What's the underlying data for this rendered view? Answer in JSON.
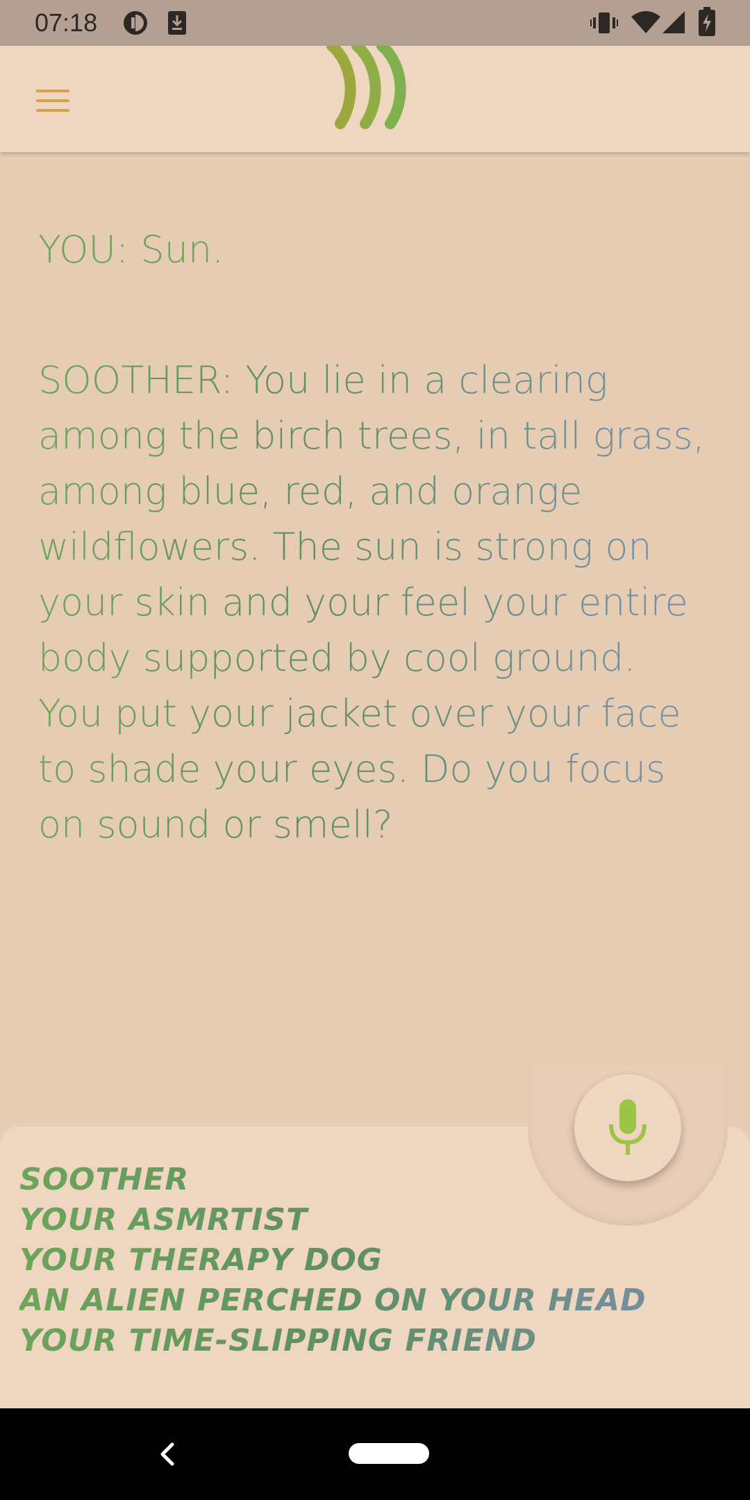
{
  "status_bar": {
    "time": "07:18",
    "left_icons": [
      "privacy-indicator-icon",
      "download-icon"
    ],
    "right_icons": [
      "vibrate-icon",
      "wifi-icon",
      "signal-icon",
      "battery-charging-icon"
    ]
  },
  "app_bar": {
    "menu_icon": "hamburger-menu-icon",
    "logo_icon": "sound-waves-logo-icon"
  },
  "conversation": {
    "messages": [
      {
        "speaker": "YOU:",
        "text": " Sun."
      },
      {
        "speaker": "SOOTHER:",
        "text": " You lie in a clearing among the birch trees, in tall grass, among blue, red, and orange wildflowers. The sun is strong on your skin and your feel your entire body supported by cool ground. You put your jacket over your face to shade your eyes. Do you focus on sound or smell?"
      }
    ]
  },
  "mic": {
    "icon": "microphone-icon"
  },
  "personas": [
    "SOOTHER",
    "YOUR ASMRTIST",
    "YOUR THERAPY DOG",
    "AN ALIEN PERCHED ON YOUR HEAD",
    "YOUR TIME-SLIPPING FRIEND"
  ],
  "nav_bar": {
    "back_icon": "back-chevron-icon",
    "home_icon": "home-pill-icon"
  },
  "colors": {
    "background": "#e6ccb2",
    "panel": "#efd6c1",
    "green": "#6da55a",
    "blue_gray": "#7a8fb0",
    "menu_gold": "#d4a24e",
    "mic_green": "#9cc446",
    "status_bar": "#b3a092"
  }
}
